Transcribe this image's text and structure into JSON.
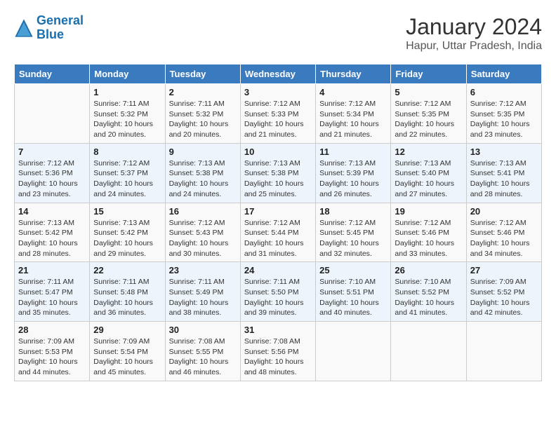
{
  "header": {
    "logo_line1": "General",
    "logo_line2": "Blue",
    "month": "January 2024",
    "location": "Hapur, Uttar Pradesh, India"
  },
  "days_of_week": [
    "Sunday",
    "Monday",
    "Tuesday",
    "Wednesday",
    "Thursday",
    "Friday",
    "Saturday"
  ],
  "weeks": [
    [
      {
        "day": "",
        "info": ""
      },
      {
        "day": "1",
        "info": "Sunrise: 7:11 AM\nSunset: 5:32 PM\nDaylight: 10 hours\nand 20 minutes."
      },
      {
        "day": "2",
        "info": "Sunrise: 7:11 AM\nSunset: 5:32 PM\nDaylight: 10 hours\nand 20 minutes."
      },
      {
        "day": "3",
        "info": "Sunrise: 7:12 AM\nSunset: 5:33 PM\nDaylight: 10 hours\nand 21 minutes."
      },
      {
        "day": "4",
        "info": "Sunrise: 7:12 AM\nSunset: 5:34 PM\nDaylight: 10 hours\nand 21 minutes."
      },
      {
        "day": "5",
        "info": "Sunrise: 7:12 AM\nSunset: 5:35 PM\nDaylight: 10 hours\nand 22 minutes."
      },
      {
        "day": "6",
        "info": "Sunrise: 7:12 AM\nSunset: 5:35 PM\nDaylight: 10 hours\nand 23 minutes."
      }
    ],
    [
      {
        "day": "7",
        "info": "Sunrise: 7:12 AM\nSunset: 5:36 PM\nDaylight: 10 hours\nand 23 minutes."
      },
      {
        "day": "8",
        "info": "Sunrise: 7:12 AM\nSunset: 5:37 PM\nDaylight: 10 hours\nand 24 minutes."
      },
      {
        "day": "9",
        "info": "Sunrise: 7:13 AM\nSunset: 5:38 PM\nDaylight: 10 hours\nand 24 minutes."
      },
      {
        "day": "10",
        "info": "Sunrise: 7:13 AM\nSunset: 5:38 PM\nDaylight: 10 hours\nand 25 minutes."
      },
      {
        "day": "11",
        "info": "Sunrise: 7:13 AM\nSunset: 5:39 PM\nDaylight: 10 hours\nand 26 minutes."
      },
      {
        "day": "12",
        "info": "Sunrise: 7:13 AM\nSunset: 5:40 PM\nDaylight: 10 hours\nand 27 minutes."
      },
      {
        "day": "13",
        "info": "Sunrise: 7:13 AM\nSunset: 5:41 PM\nDaylight: 10 hours\nand 28 minutes."
      }
    ],
    [
      {
        "day": "14",
        "info": "Sunrise: 7:13 AM\nSunset: 5:42 PM\nDaylight: 10 hours\nand 28 minutes."
      },
      {
        "day": "15",
        "info": "Sunrise: 7:13 AM\nSunset: 5:42 PM\nDaylight: 10 hours\nand 29 minutes."
      },
      {
        "day": "16",
        "info": "Sunrise: 7:12 AM\nSunset: 5:43 PM\nDaylight: 10 hours\nand 30 minutes."
      },
      {
        "day": "17",
        "info": "Sunrise: 7:12 AM\nSunset: 5:44 PM\nDaylight: 10 hours\nand 31 minutes."
      },
      {
        "day": "18",
        "info": "Sunrise: 7:12 AM\nSunset: 5:45 PM\nDaylight: 10 hours\nand 32 minutes."
      },
      {
        "day": "19",
        "info": "Sunrise: 7:12 AM\nSunset: 5:46 PM\nDaylight: 10 hours\nand 33 minutes."
      },
      {
        "day": "20",
        "info": "Sunrise: 7:12 AM\nSunset: 5:46 PM\nDaylight: 10 hours\nand 34 minutes."
      }
    ],
    [
      {
        "day": "21",
        "info": "Sunrise: 7:11 AM\nSunset: 5:47 PM\nDaylight: 10 hours\nand 35 minutes."
      },
      {
        "day": "22",
        "info": "Sunrise: 7:11 AM\nSunset: 5:48 PM\nDaylight: 10 hours\nand 36 minutes."
      },
      {
        "day": "23",
        "info": "Sunrise: 7:11 AM\nSunset: 5:49 PM\nDaylight: 10 hours\nand 38 minutes."
      },
      {
        "day": "24",
        "info": "Sunrise: 7:11 AM\nSunset: 5:50 PM\nDaylight: 10 hours\nand 39 minutes."
      },
      {
        "day": "25",
        "info": "Sunrise: 7:10 AM\nSunset: 5:51 PM\nDaylight: 10 hours\nand 40 minutes."
      },
      {
        "day": "26",
        "info": "Sunrise: 7:10 AM\nSunset: 5:52 PM\nDaylight: 10 hours\nand 41 minutes."
      },
      {
        "day": "27",
        "info": "Sunrise: 7:09 AM\nSunset: 5:52 PM\nDaylight: 10 hours\nand 42 minutes."
      }
    ],
    [
      {
        "day": "28",
        "info": "Sunrise: 7:09 AM\nSunset: 5:53 PM\nDaylight: 10 hours\nand 44 minutes."
      },
      {
        "day": "29",
        "info": "Sunrise: 7:09 AM\nSunset: 5:54 PM\nDaylight: 10 hours\nand 45 minutes."
      },
      {
        "day": "30",
        "info": "Sunrise: 7:08 AM\nSunset: 5:55 PM\nDaylight: 10 hours\nand 46 minutes."
      },
      {
        "day": "31",
        "info": "Sunrise: 7:08 AM\nSunset: 5:56 PM\nDaylight: 10 hours\nand 48 minutes."
      },
      {
        "day": "",
        "info": ""
      },
      {
        "day": "",
        "info": ""
      },
      {
        "day": "",
        "info": ""
      }
    ]
  ]
}
